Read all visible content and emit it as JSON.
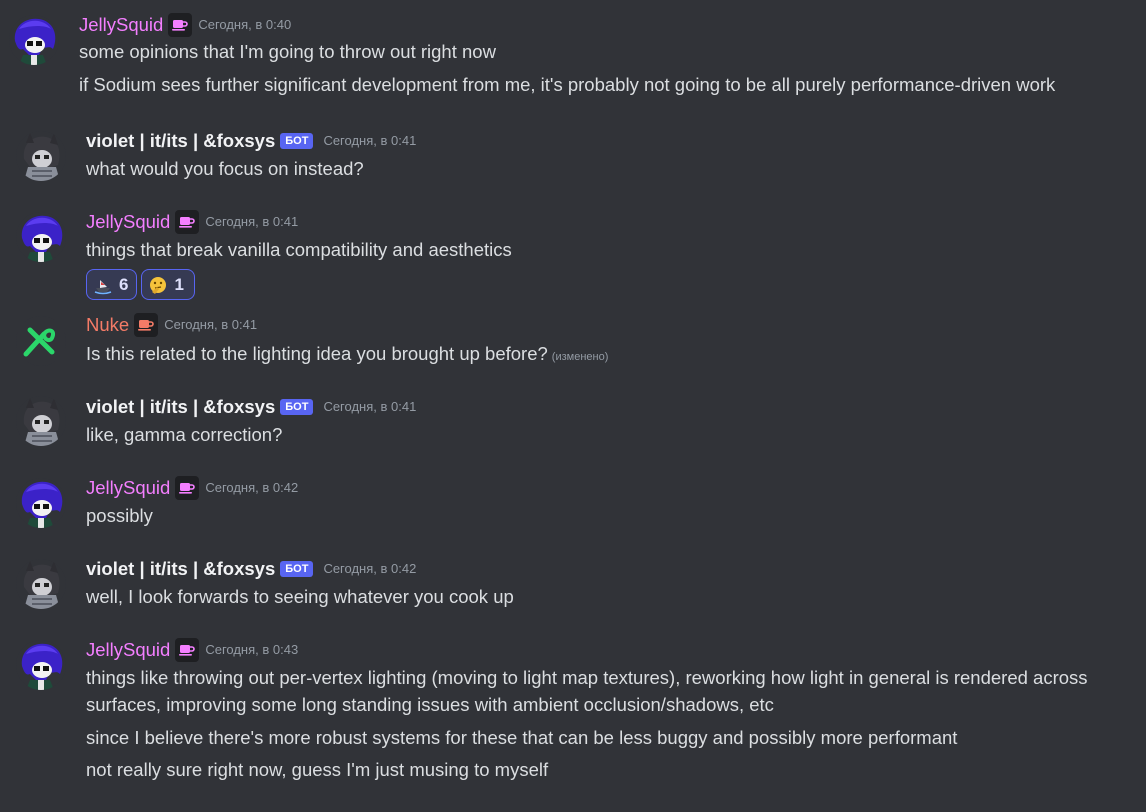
{
  "messages": [
    {
      "author": "JellySquid",
      "timestamp": "Сегодня, в 0:40",
      "lines": [
        "some opinions that I'm going to throw out right now",
        "if Sodium sees further significant development from me, it's probably not going to be all purely performance-driven work"
      ]
    },
    {
      "author": "violet | it/its | &foxsys",
      "bot_tag": "БОТ",
      "timestamp": "Сегодня, в 0:41",
      "lines": [
        "what would you focus on instead?"
      ]
    },
    {
      "author": "JellySquid",
      "timestamp": "Сегодня, в 0:41",
      "lines": [
        "things that break vanilla compatibility and aesthetics"
      ],
      "reactions": [
        {
          "emoji": "ship-emoji",
          "count": "6"
        },
        {
          "emoji": "thinking-face-emoji",
          "count": "1"
        }
      ]
    },
    {
      "author": "Nuke",
      "timestamp": "Сегодня, в 0:41",
      "lines": [
        "Is this related to the lighting idea you brought up before?"
      ],
      "edited": "(изменено)"
    },
    {
      "author": "violet | it/its | &foxsys",
      "bot_tag": "БОТ",
      "timestamp": "Сегодня, в 0:41",
      "lines": [
        "like, gamma correction?"
      ]
    },
    {
      "author": "JellySquid",
      "timestamp": "Сегодня, в 0:42",
      "lines": [
        "possibly"
      ]
    },
    {
      "author": "violet | it/its | &foxsys",
      "bot_tag": "БОТ",
      "timestamp": "Сегодня, в 0:42",
      "lines": [
        "well, I look forwards to seeing whatever you cook up"
      ]
    },
    {
      "author": "JellySquid",
      "timestamp": "Сегодня, в 0:43",
      "lines": [
        "things like throwing out per-vertex lighting (moving to light map textures), reworking how light in general is rendered across",
        "surfaces, improving some long standing issues with ambient occlusion/shadows, etc",
        "since I believe there's more robust systems for these that can be less buggy and possibly more performant",
        "not really sure right now, guess I'm just musing to myself"
      ]
    }
  ],
  "colors": {
    "background": "#313338",
    "jellysquid_name": "#f47fff",
    "nuke_name": "#f47b67",
    "violet_name": "#f2f3f5",
    "bot_tag": "#5865f2",
    "timestamp": "#949ba4",
    "text": "#dbdee1"
  }
}
